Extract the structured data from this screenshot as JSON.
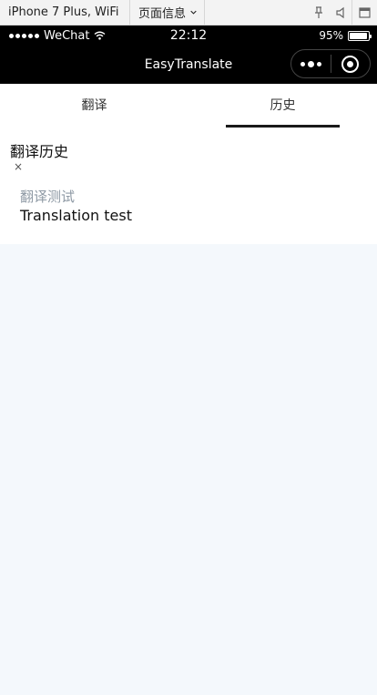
{
  "devtools": {
    "device_select": "iPhone 7 Plus, WiFi",
    "page_info_select": "页面信息",
    "icons": [
      "pin-icon",
      "speaker-icon",
      "window-icon"
    ]
  },
  "statusbar": {
    "carrier": "WeChat",
    "time": "22:12",
    "battery": "95%",
    "battery_level": 0.95
  },
  "navbar": {
    "title": "EasyTranslate"
  },
  "tabs": [
    {
      "label": "翻译",
      "active": false
    },
    {
      "label": "历史",
      "active": true
    }
  ],
  "history": {
    "title": "翻译历史",
    "clear_icon": "×",
    "items": [
      {
        "source": "翻译测试",
        "target": "Translation test"
      }
    ]
  }
}
